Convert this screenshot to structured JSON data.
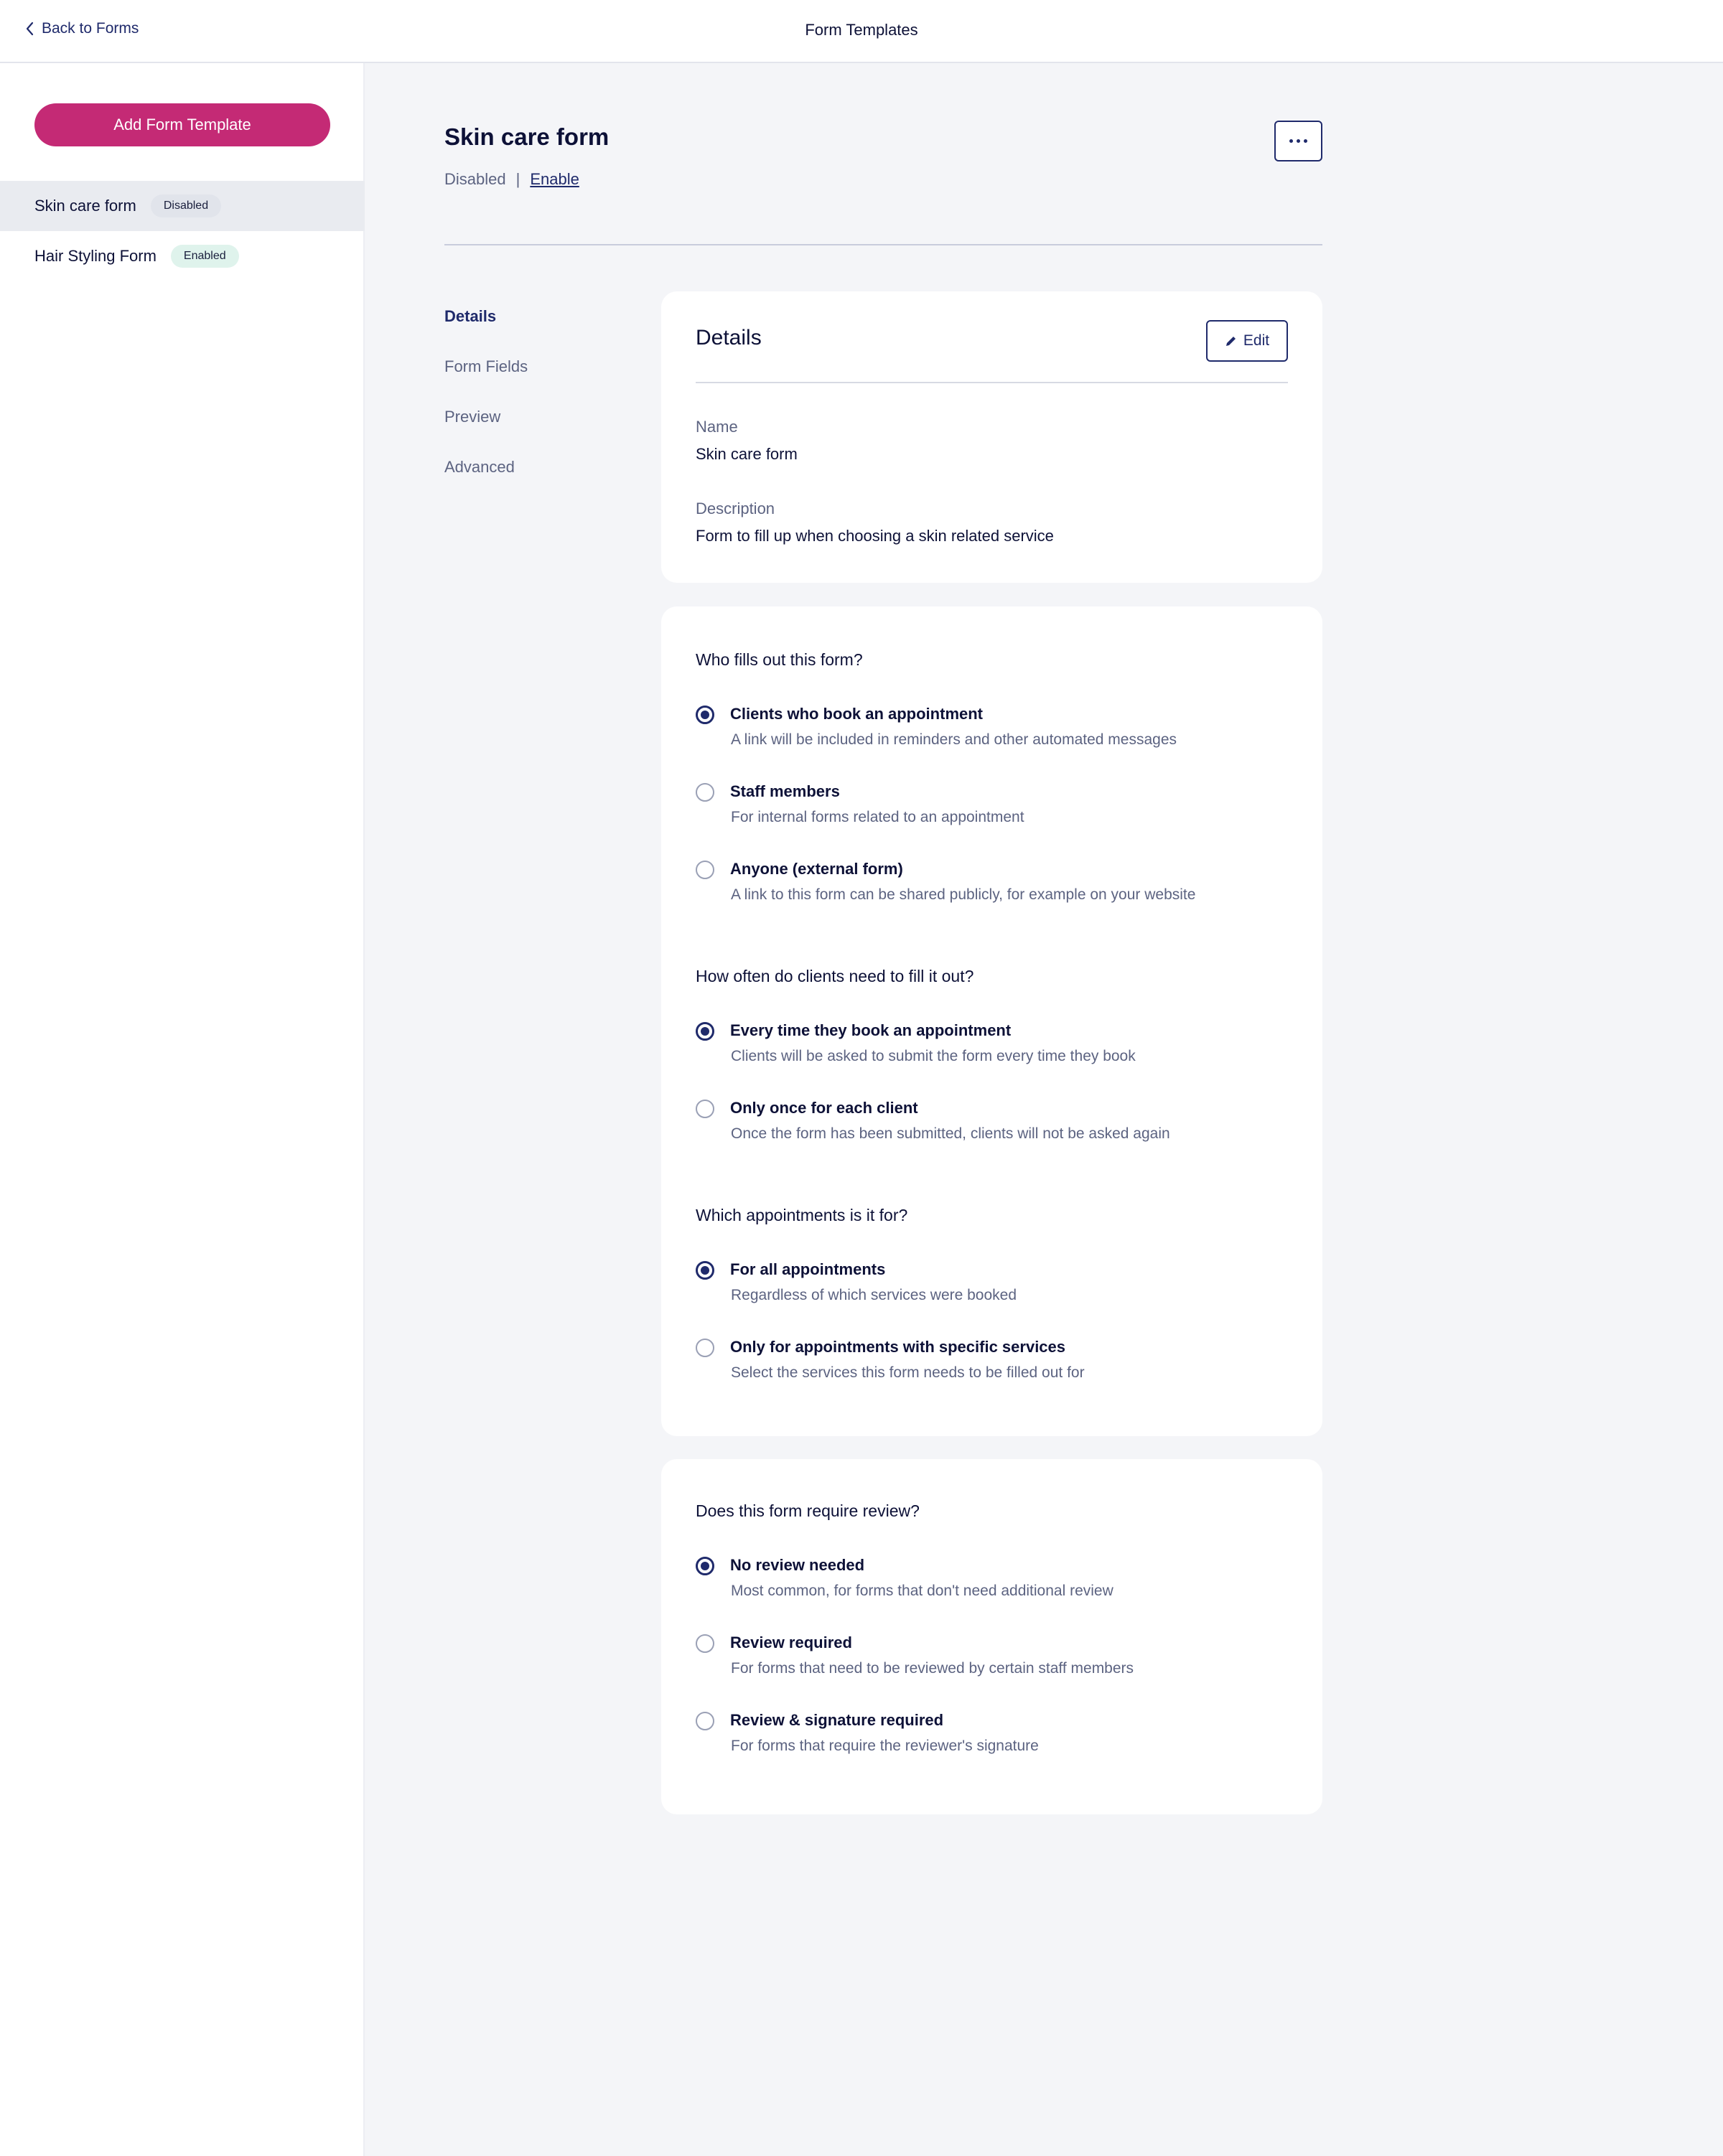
{
  "topbar": {
    "back_label": "Back to Forms",
    "title": "Form Templates"
  },
  "sidebar": {
    "add_button": "Add Form Template",
    "items": [
      {
        "label": "Skin care form",
        "badge": "Disabled"
      },
      {
        "label": "Hair Styling Form",
        "badge": "Enabled"
      }
    ]
  },
  "header": {
    "title": "Skin care form",
    "status": "Disabled",
    "separator": "|",
    "enable_link": "Enable"
  },
  "subnav": [
    "Details",
    "Form Fields",
    "Preview",
    "Advanced"
  ],
  "details_card": {
    "title": "Details",
    "edit_label": "Edit",
    "name_label": "Name",
    "name_value": "Skin care form",
    "description_label": "Description",
    "description_value": "Form to fill up when choosing a skin related service"
  },
  "settings": {
    "who": {
      "question": "Who fills out this form?",
      "options": [
        {
          "label": "Clients who book an appointment",
          "desc": "A link will be included in reminders and other automated messages",
          "selected": true
        },
        {
          "label": "Staff members",
          "desc": "For internal forms related to an appointment",
          "selected": false
        },
        {
          "label": "Anyone (external form)",
          "desc": "A link to this form can be shared publicly, for example on your website",
          "selected": false
        }
      ]
    },
    "frequency": {
      "question": "How often do clients need to fill it out?",
      "options": [
        {
          "label": "Every time they book an appointment",
          "desc": "Clients will be asked to submit the form every time they book",
          "selected": true
        },
        {
          "label": "Only once for each client",
          "desc": "Once the form has been submitted, clients will not be asked again",
          "selected": false
        }
      ]
    },
    "appointments": {
      "question": "Which appointments is it for?",
      "options": [
        {
          "label": "For all appointments",
          "desc": "Regardless of which services were booked",
          "selected": true
        },
        {
          "label": "Only for appointments with specific services",
          "desc": "Select the services this form needs to be filled out for",
          "selected": false
        }
      ]
    }
  },
  "review": {
    "question": "Does this form require review?",
    "options": [
      {
        "label": "No review needed",
        "desc": "Most common, for forms that don't need additional review",
        "selected": true
      },
      {
        "label": "Review required",
        "desc": "For forms that need to be reviewed by certain staff members",
        "selected": false
      },
      {
        "label": "Review & signature required",
        "desc": "For forms that require the reviewer's signature",
        "selected": false
      }
    ]
  },
  "colors": {
    "brand": "#c42a75",
    "navy": "#1f2a6b",
    "text": "#0d1137",
    "muted": "#5c6381",
    "background": "#f4f5f8"
  }
}
